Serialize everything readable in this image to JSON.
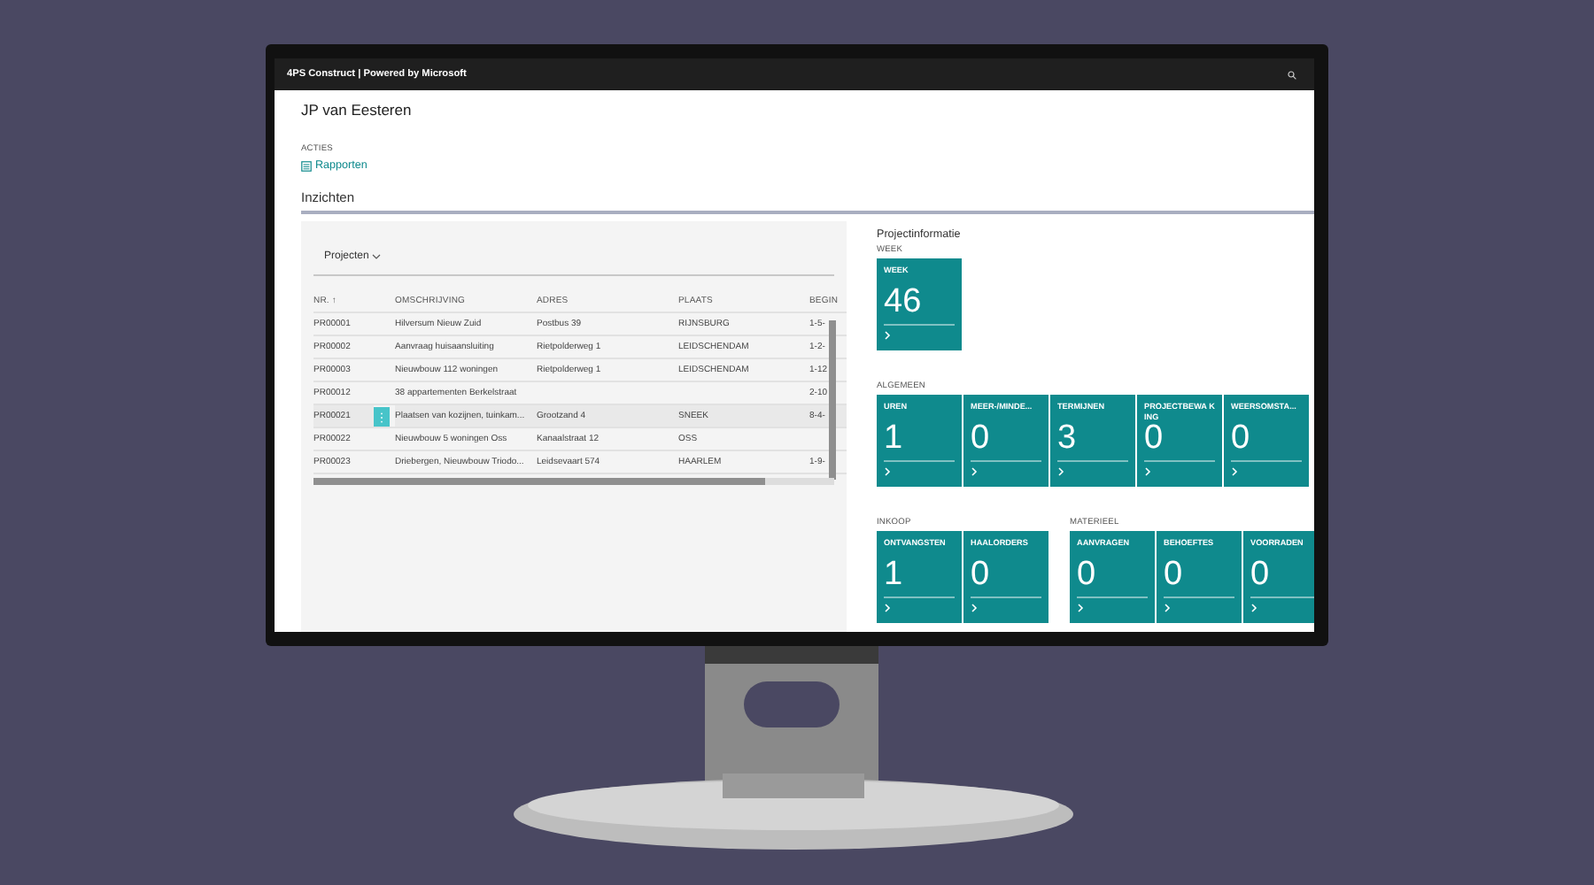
{
  "window": {
    "title": "4PS Construct | Powered by Microsoft"
  },
  "page": {
    "title": "JP van Eesteren"
  },
  "actions": {
    "heading": "ACTIES",
    "items": [
      {
        "label": "Rapporten"
      }
    ]
  },
  "insights": {
    "heading": "Inzichten"
  },
  "projects": {
    "view": "Projecten",
    "columns": [
      "NR. ↑",
      "OMSCHRIJVING",
      "ADRES",
      "PLAATS",
      "BEGIN"
    ],
    "rows": [
      {
        "cells": [
          "PR00001",
          "Hilversum Nieuw Zuid",
          "Postbus 39",
          "RIJNSBURG",
          "1-5-"
        ],
        "selected": false
      },
      {
        "cells": [
          "PR00002",
          "Aanvraag huisaansluiting",
          "Rietpolderweg 1",
          "LEIDSCHENDAM",
          "1-2-"
        ],
        "selected": false
      },
      {
        "cells": [
          "PR00003",
          "Nieuwbouw 112 woningen",
          "Rietpolderweg 1",
          "LEIDSCHENDAM",
          "1-12"
        ],
        "selected": false
      },
      {
        "cells": [
          "PR00012",
          "38 appartementen Berkelstraat",
          "",
          "",
          "2-10"
        ],
        "selected": false
      },
      {
        "cells": [
          "PR00021",
          "Plaatsen van kozijnen, tuinkam...",
          "Grootzand 4",
          "SNEEK",
          "8-4-"
        ],
        "selected": true
      },
      {
        "cells": [
          "PR00022",
          "Nieuwbouw 5 woningen Oss",
          "Kanaalstraat 12",
          "OSS",
          ""
        ],
        "selected": false
      },
      {
        "cells": [
          "PR00023",
          "Driebergen, Nieuwbouw Triodo...",
          "Leidsevaart 574",
          "HAARLEM",
          "1-9-"
        ],
        "selected": false
      }
    ]
  },
  "project_info": {
    "title": "Projectinformatie",
    "rows": [
      {
        "groups": [
          {
            "heading": "WEEK",
            "tiles": [
              {
                "label": "WEEK",
                "value": "46"
              }
            ]
          }
        ]
      },
      {
        "groups": [
          {
            "heading": "ALGEMEEN",
            "tiles": [
              {
                "label": "UREN",
                "value": "1"
              },
              {
                "label": "MEER-/MINDE...",
                "value": "0"
              },
              {
                "label": "TERMIJNEN",
                "value": "3"
              },
              {
                "label": "PROJECTBEWA KING",
                "value": "0"
              },
              {
                "label": "WEERSOMSTA...",
                "value": "0"
              }
            ]
          }
        ]
      },
      {
        "groups": [
          {
            "heading": "INKOOP",
            "tiles": [
              {
                "label": "ONTVANGSTEN",
                "value": "1"
              },
              {
                "label": "HAALORDERS",
                "value": "0"
              }
            ]
          },
          {
            "heading": "MATERIEEL",
            "tiles": [
              {
                "label": "AANVRAGEN",
                "value": "0"
              },
              {
                "label": "BEHOEFTES",
                "value": "0"
              },
              {
                "label": "VOORRADEN",
                "value": "0"
              }
            ]
          }
        ]
      }
    ]
  }
}
